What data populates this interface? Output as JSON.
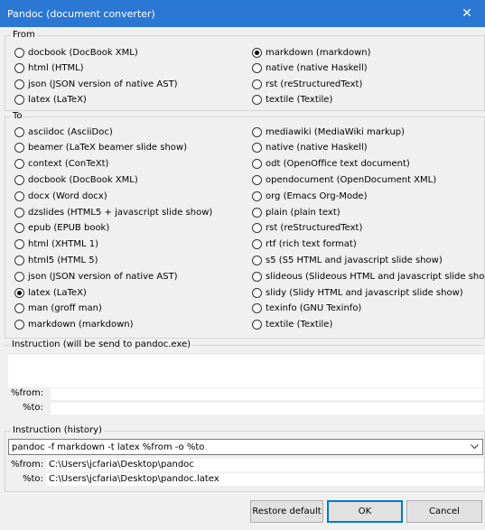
{
  "window": {
    "title": "Pandoc (document converter)",
    "close_glyph": "✕"
  },
  "from": {
    "legend": "From",
    "left": [
      {
        "label": "docbook (DocBook XML)",
        "checked": false
      },
      {
        "label": "html (HTML)",
        "checked": false
      },
      {
        "label": "json (JSON version of native AST)",
        "checked": false
      },
      {
        "label": "latex (LaTeX)",
        "checked": false
      }
    ],
    "right": [
      {
        "label": "markdown (markdown)",
        "checked": true
      },
      {
        "label": "native (native Haskell)",
        "checked": false
      },
      {
        "label": "rst (reStructuredText)",
        "checked": false
      },
      {
        "label": "textile (Textile)",
        "checked": false
      }
    ]
  },
  "to": {
    "legend": "To",
    "left": [
      {
        "label": "asciidoc (AsciiDoc)",
        "checked": false
      },
      {
        "label": "beamer (LaTeX beamer slide show)",
        "checked": false
      },
      {
        "label": "context (ConTeXt)",
        "checked": false
      },
      {
        "label": "docbook (DocBook XML)",
        "checked": false
      },
      {
        "label": "docx (Word docx)",
        "checked": false
      },
      {
        "label": "dzslides (HTML5 + javascript slide show)",
        "checked": false
      },
      {
        "label": "epub (EPUB book)",
        "checked": false
      },
      {
        "label": "html (XHTML 1)",
        "checked": false
      },
      {
        "label": "html5 (HTML 5)",
        "checked": false
      },
      {
        "label": "json (JSON version of native AST)",
        "checked": false
      },
      {
        "label": "latex (LaTeX)",
        "checked": true
      },
      {
        "label": "man (groff man)",
        "checked": false
      },
      {
        "label": "markdown (markdown)",
        "checked": false
      }
    ],
    "right": [
      {
        "label": "mediawiki (MediaWiki markup)",
        "checked": false
      },
      {
        "label": "native (native Haskell)",
        "checked": false
      },
      {
        "label": "odt (OpenOffice text document)",
        "checked": false
      },
      {
        "label": "opendocument (OpenDocument XML)",
        "checked": false
      },
      {
        "label": "org (Emacs Org-Mode)",
        "checked": false
      },
      {
        "label": "plain (plain text)",
        "checked": false
      },
      {
        "label": "rst (reStructuredText)",
        "checked": false
      },
      {
        "label": "rtf (rich text format)",
        "checked": false
      },
      {
        "label": "s5 (S5 HTML and javascript slide show)",
        "checked": false
      },
      {
        "label": "slideous (Slideous HTML and javascript slide show)",
        "checked": false
      },
      {
        "label": "slidy (Slidy HTML and javascript slide show)",
        "checked": false
      },
      {
        "label": "texinfo (GNU Texinfo)",
        "checked": false
      },
      {
        "label": "textile (Textile)",
        "checked": false
      }
    ]
  },
  "instruction": {
    "legend": "Instruction (will be send to pandoc.exe)",
    "text": "",
    "from_label": "%from:",
    "from_value": "",
    "to_label": "%to:",
    "to_value": ""
  },
  "history": {
    "legend": "Instruction (history)",
    "command": "pandoc -f markdown -t latex %from -o %to",
    "from_label": "%from:",
    "from_value": "C:\\Users\\jcfaria\\Desktop\\pandoc",
    "to_label": "%to:",
    "to_value": "C:\\Users\\jcfaria\\Desktop\\pandoc.latex"
  },
  "buttons": {
    "restore": "Restore default",
    "ok": "OK",
    "cancel": "Cancel"
  }
}
